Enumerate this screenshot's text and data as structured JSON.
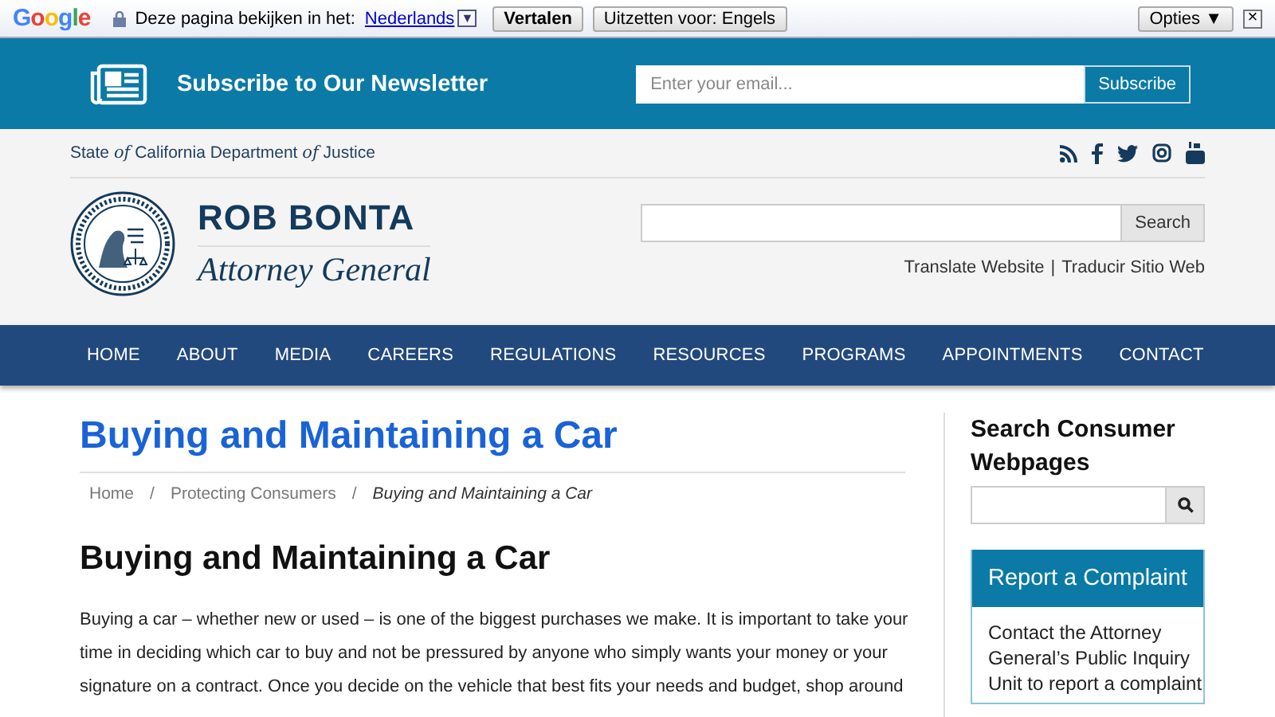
{
  "translate_bar": {
    "brand": "Google",
    "prompt": "Deze pagina bekijken in het:",
    "language": "Nederlands",
    "language_caret": "▼",
    "translate_button": "Vertalen",
    "off_button": "Uitzetten voor: Engels",
    "options_button": "Opties ▼",
    "close": "×"
  },
  "newsletter": {
    "title": "Subscribe to Our Newsletter",
    "email": {
      "placeholder": "Enter your email..."
    },
    "button": "Subscribe"
  },
  "header": {
    "department": {
      "parts": [
        "State ",
        "of",
        " California Department ",
        "of",
        " Justice"
      ]
    },
    "name": "ROB BONTA",
    "role": "Attorney General",
    "search_button": "Search",
    "translate_links": [
      "Translate Website",
      "Traducir Sitio Web"
    ],
    "separator": "|"
  },
  "nav": [
    {
      "label": "HOME"
    },
    {
      "label": "ABOUT"
    },
    {
      "label": "MEDIA"
    },
    {
      "label": "CAREERS"
    },
    {
      "label": "REGULATIONS"
    },
    {
      "label": "RESOURCES"
    },
    {
      "label": "PROGRAMS"
    },
    {
      "label": "APPOINTMENTS"
    },
    {
      "label": "CONTACT"
    }
  ],
  "page": {
    "title": "Buying and Maintaining a Car",
    "breadcrumbs": [
      {
        "label": "Home",
        "current": false
      },
      {
        "label": "Protecting Consumers",
        "current": false
      },
      {
        "label": "Buying and Maintaining a Car",
        "current": true
      }
    ],
    "breadcrumb_separator": "/",
    "heading": "Buying and Maintaining a Car",
    "paragraph_lines": [
      "Buying a car – whether new or used – is one of the biggest purchases we make. It is important to take your",
      "time in deciding which car to buy and not be pressured by anyone who simply wants your money or your",
      "signature on a contract. Once you decide on the vehicle that best fits your needs and budget, shop around"
    ]
  },
  "sidebar": {
    "search_title": "Search Consumer Webpages",
    "complaint": {
      "title": "Report a Complaint",
      "lines": [
        "Contact the Attorney",
        "General’s Public Inquiry",
        "Unit to report a complaint"
      ]
    }
  }
}
